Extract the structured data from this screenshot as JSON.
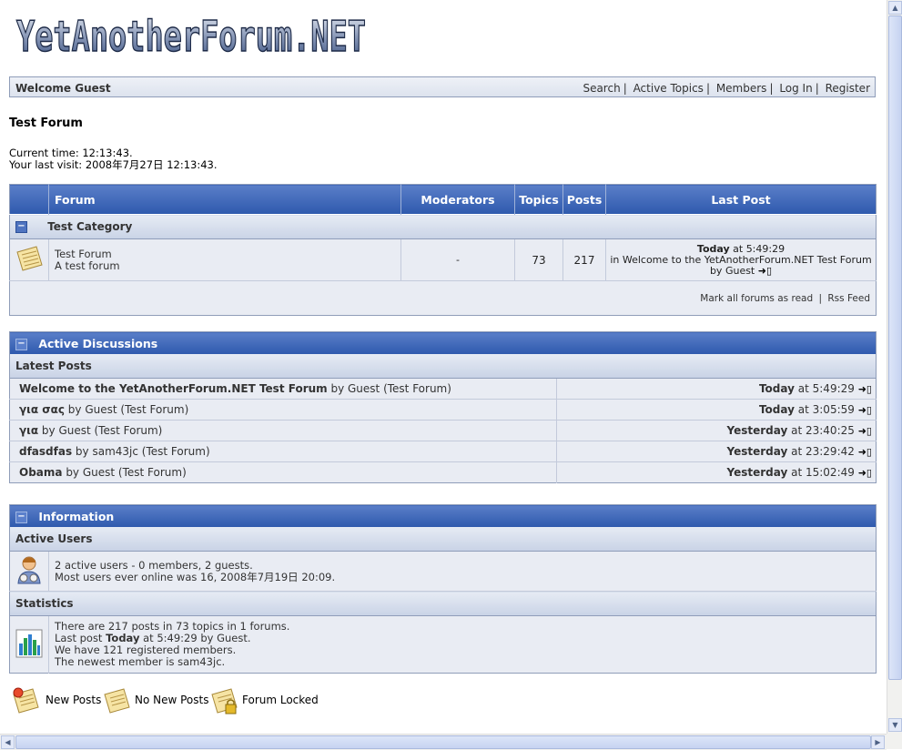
{
  "logo_text": "YetAnotherForum.NET",
  "welcome": "Welcome Guest",
  "nav": [
    "Search",
    "Active Topics",
    "Members",
    "Log In",
    "Register"
  ],
  "forum_title": "Test Forum",
  "time": {
    "current": "Current time: 12:13:43.",
    "last_visit": "Your last visit: 2008年7月27日 12:13:43."
  },
  "forum_table": {
    "headers": {
      "forum": "Forum",
      "moderators": "Moderators",
      "topics": "Topics",
      "posts": "Posts",
      "last_post": "Last Post"
    },
    "category": "Test Category",
    "row": {
      "name": "Test Forum",
      "description": "A test forum",
      "moderators": "-",
      "topics": "73",
      "posts": "217",
      "last_post_day": "Today",
      "last_post_time": " at 5:49:29",
      "last_post_in": "in Welcome to the YetAnotherForum.NET Test Forum",
      "last_post_by": "by Guest"
    },
    "footer_links": [
      "Mark all forums as read",
      "Rss Feed"
    ]
  },
  "active_discussions": {
    "title": "Active Discussions",
    "subtitle": "Latest Posts",
    "posts": [
      {
        "topic": "Welcome to the YetAnotherForum.NET Test Forum",
        "by": " by Guest ",
        "forum": "(Test Forum)",
        "day": "Today",
        "time": " at 5:49:29"
      },
      {
        "topic": "για σας",
        "by": " by Guest ",
        "forum": "(Test Forum)",
        "day": "Today",
        "time": " at 3:05:59"
      },
      {
        "topic": "για",
        "by": " by Guest ",
        "forum": "(Test Forum)",
        "day": "Yesterday",
        "time": " at 23:40:25"
      },
      {
        "topic": "dfasdfas",
        "by": " by sam43jc ",
        "forum": "(Test Forum)",
        "day": "Yesterday",
        "time": " at 23:29:42"
      },
      {
        "topic": "Obama",
        "by": " by Guest ",
        "forum": "(Test Forum)",
        "day": "Yesterday",
        "time": " at 15:02:49"
      }
    ]
  },
  "information": {
    "title": "Information",
    "active_users_title": "Active Users",
    "active_users_line1": "2 active users - 0 members, 2 guests.",
    "active_users_line2": "Most users ever online was 16, 2008年7月19日 20:09.",
    "statistics_title": "Statistics",
    "stats_line1": "There are 217 posts in 73 topics in 1 forums.",
    "stats_line2_pre": "Last post ",
    "stats_line2_day": "Today",
    "stats_line2_post": " at 5:49:29 by Guest.",
    "stats_line3": "We have 121 registered members.",
    "stats_line4": "The newest member is sam43jc."
  },
  "legend": [
    "New Posts",
    "No New Posts",
    "Forum Locked"
  ],
  "colors": {
    "header_blue": "#2e59ad",
    "row_bg": "#e9ecf3",
    "border": "#8f9db9"
  }
}
